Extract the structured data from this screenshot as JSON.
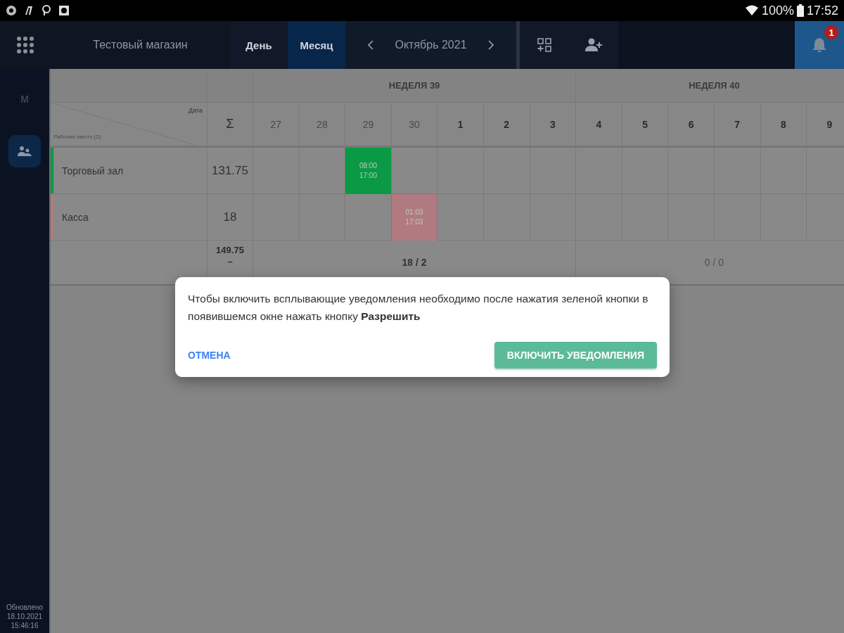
{
  "status_bar": {
    "battery": "100%",
    "time": "17:52"
  },
  "app_bar": {
    "store": "Тестовый магазин",
    "view_tabs": [
      {
        "label": "День",
        "selected": false
      },
      {
        "label": "Месяц",
        "selected": true
      }
    ],
    "period": "Октябрь 2021",
    "notifications": {
      "count": "1"
    }
  },
  "sidebar": {
    "items": [
      {
        "kind": "letter",
        "label": "М",
        "selected": false
      },
      {
        "kind": "people",
        "selected": true
      }
    ],
    "updated": [
      "Обновлено",
      "18.10.2021",
      "15:46:16"
    ]
  },
  "table": {
    "corner": {
      "top": "Дата",
      "bottom": "Рабочее место (2)"
    },
    "sum_header": "Σ",
    "weeks": [
      {
        "label": "НЕДЕЛЯ 39",
        "total": "18 / 2",
        "days": [
          {
            "label": "27",
            "past": true
          },
          {
            "label": "28",
            "past": true
          },
          {
            "label": "29",
            "past": true
          },
          {
            "label": "30",
            "past": true
          },
          {
            "label": "1",
            "past": false
          },
          {
            "label": "2",
            "past": false
          },
          {
            "label": "3",
            "past": false
          }
        ]
      },
      {
        "label": "НЕДЕЛЯ 40",
        "total": "0 / 0",
        "days": [
          {
            "label": "4",
            "past": false
          },
          {
            "label": "5",
            "past": false
          },
          {
            "label": "6",
            "past": false
          },
          {
            "label": "7",
            "past": false
          },
          {
            "label": "8",
            "past": false
          },
          {
            "label": "9",
            "past": false
          }
        ]
      }
    ],
    "rows": [
      {
        "name": "Торговый зал",
        "color": "#0a9a45",
        "sum": "131.75",
        "cells": [
          {
            "kind": "empty"
          },
          {
            "kind": "empty"
          },
          {
            "kind": "shift",
            "start": "08:00",
            "end": "17:00"
          },
          {
            "kind": "empty"
          },
          {
            "kind": "empty"
          },
          {
            "kind": "empty"
          },
          {
            "kind": "empty"
          },
          {
            "kind": "empty"
          },
          {
            "kind": "empty"
          },
          {
            "kind": "empty"
          },
          {
            "kind": "empty"
          },
          {
            "kind": "empty"
          },
          {
            "kind": "empty"
          }
        ]
      },
      {
        "name": "Касса",
        "color": "#b07a80",
        "sum": "18",
        "cells": [
          {
            "kind": "empty"
          },
          {
            "kind": "empty"
          },
          {
            "kind": "empty"
          },
          {
            "kind": "shift",
            "start": "01:03",
            "end": "17:03"
          },
          {
            "kind": "empty"
          },
          {
            "kind": "empty"
          },
          {
            "kind": "empty"
          },
          {
            "kind": "empty"
          },
          {
            "kind": "empty"
          },
          {
            "kind": "empty"
          },
          {
            "kind": "empty"
          },
          {
            "kind": "empty"
          },
          {
            "kind": "empty"
          }
        ]
      }
    ],
    "grand_total": [
      "149.75",
      "–"
    ]
  },
  "dialog": {
    "message": "Чтобы включить всплывающие уведомления необходимо после нажатия зеленой кнопки в появившемся окне нажать кнопку **Разрешить**",
    "cancel": "ОТМЕНА",
    "confirm": "ВКЛЮЧИТЬ УВЕДОМЛЕНИЯ"
  }
}
